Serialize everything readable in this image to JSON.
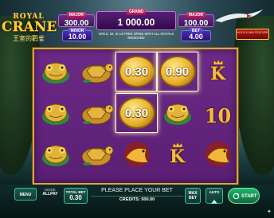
{
  "header": {
    "logo": {
      "line1": "ROYAL",
      "line2": "CRANE",
      "line3": "王室的鹳雀"
    },
    "mini": {
      "label": "MAJOR",
      "value": "300.00"
    },
    "minor": {
      "label": "MINOR",
      "value": "10.00"
    },
    "grand": {
      "label": "GRAND",
      "value": "1 000.00"
    },
    "major": {
      "label": "MAJOR",
      "value": "100.00"
    },
    "bet": {
      "label": "BET",
      "value": "4.00"
    },
    "note": "WIN 6, 10, or 14 FREE SPINS WITH ALL ROYALS REMOVED",
    "promo": "HOLD & WIN FEATURE"
  },
  "reels": [
    [
      {
        "type": "frog"
      },
      {
        "type": "turtle"
      },
      {
        "type": "coin",
        "value": "0.30"
      },
      {
        "type": "coin",
        "value": "0.90"
      },
      {
        "type": "letter",
        "text": "K",
        "crown": true
      }
    ],
    [
      {
        "type": "frog"
      },
      {
        "type": "turtle"
      },
      {
        "type": "coin",
        "value": "0.30"
      },
      {
        "type": "frog"
      },
      {
        "type": "letter",
        "text": "10"
      }
    ],
    [
      {
        "type": "frog"
      },
      {
        "type": "turtle"
      },
      {
        "type": "fish"
      },
      {
        "type": "letter",
        "text": "K",
        "crown": true
      },
      {
        "type": "fish"
      }
    ]
  ],
  "bottom": {
    "menu": "MENU",
    "mode_label": "MODE",
    "mode_value": "ALLPAY",
    "total_bet_label": "TOTAL BET",
    "total_bet_value": "0.30",
    "message": "PLEASE PLACE YOUR BET",
    "credits": "CREDITS: 500.00",
    "max_bet": "MAX\nBET",
    "auto": "AUTO",
    "start": "START"
  },
  "colors": {
    "accent_gold": "#d9a63a",
    "reel_purple": "#6c2a86",
    "button_teal": "#3bbf9a"
  }
}
